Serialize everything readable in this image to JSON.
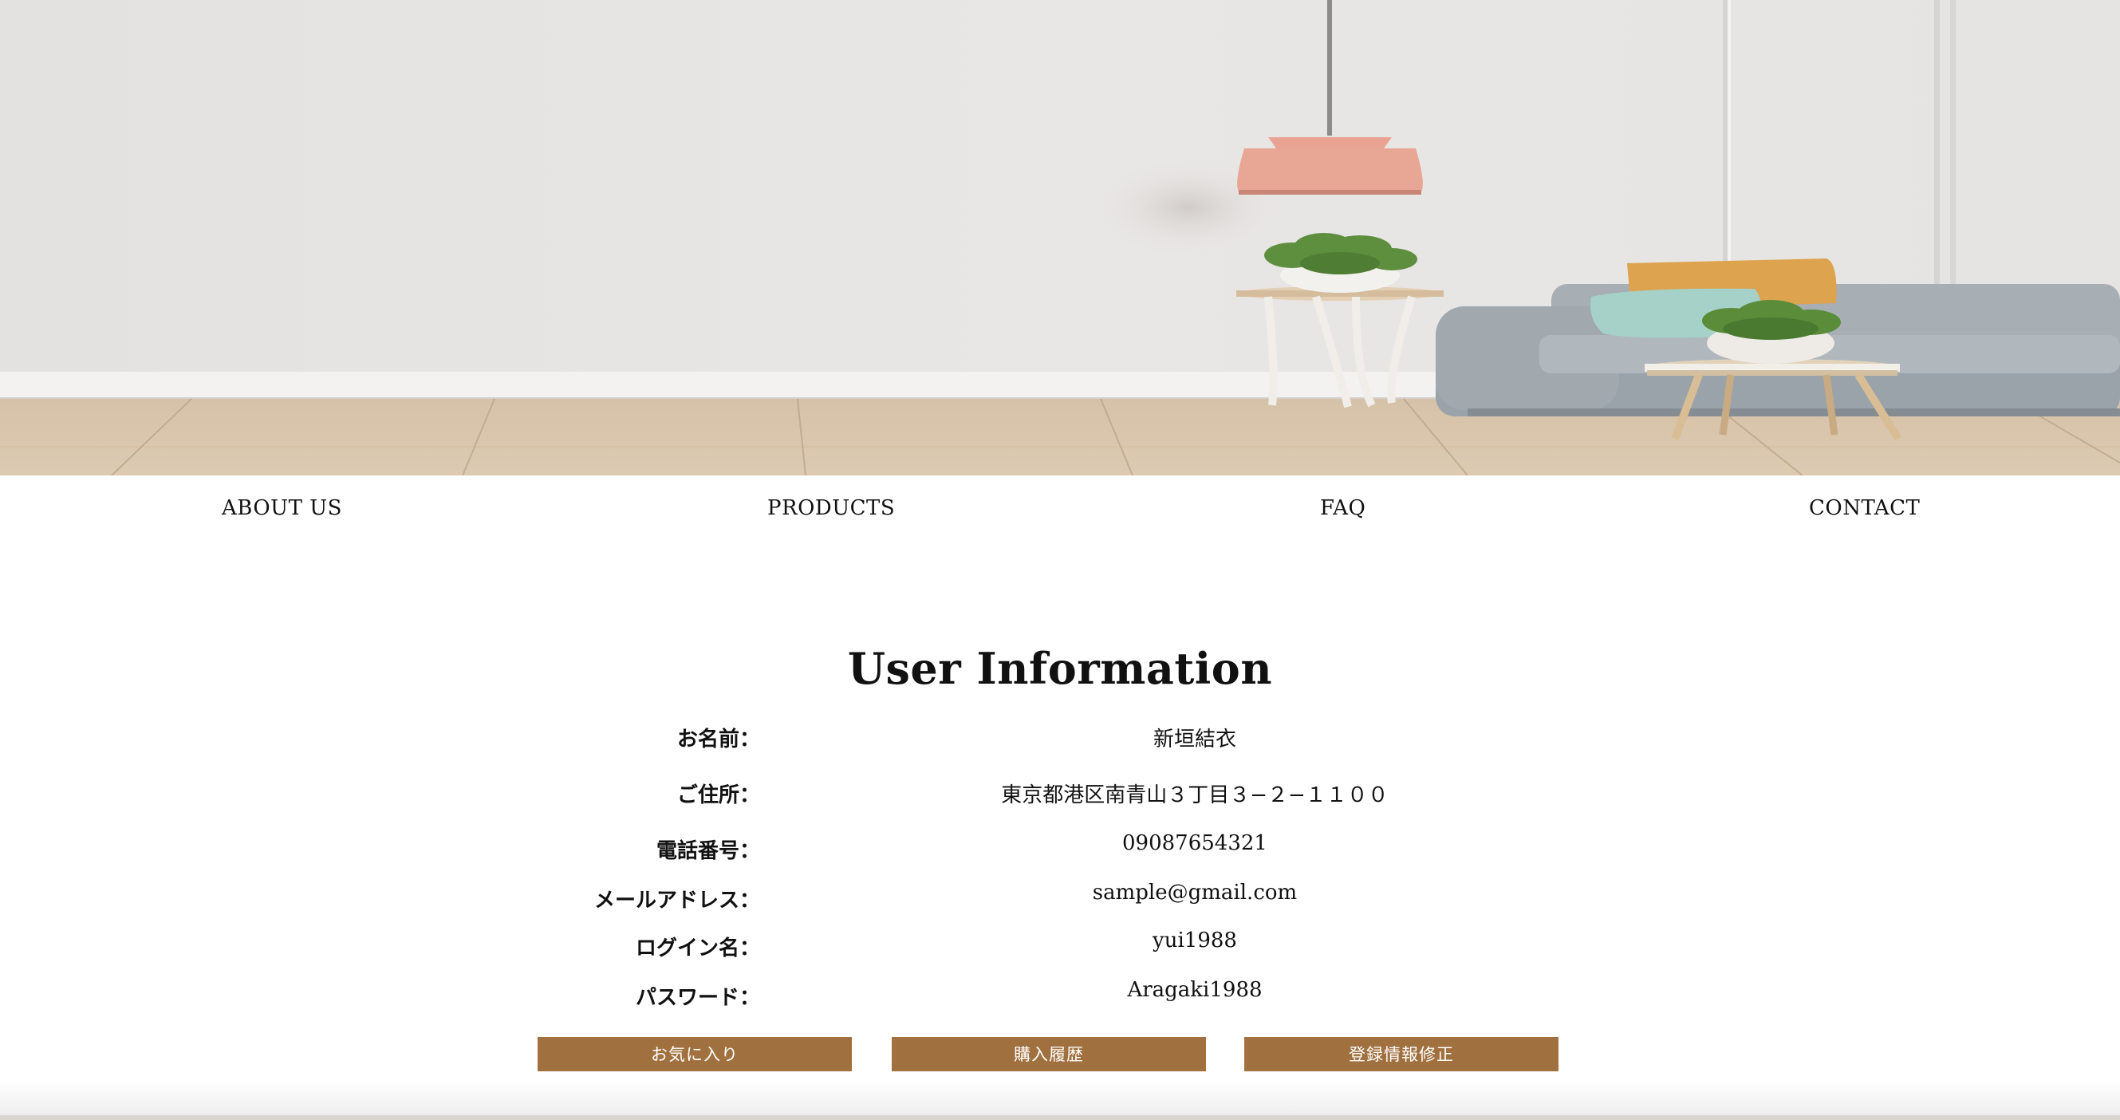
{
  "nav": {
    "items": [
      "ABOUT US",
      "PRODUCTS",
      "FAQ",
      "CONTACT"
    ]
  },
  "user_info": {
    "title": "User Information",
    "rows": [
      {
        "label": "お名前：",
        "value": "新垣結衣"
      },
      {
        "label": "ご住所：",
        "value": "東京都港区南青山３丁目３−２−１１００"
      },
      {
        "label": "電話番号：",
        "value": "09087654321"
      },
      {
        "label": "メールアドレス：",
        "value": "sample@gmail.com"
      },
      {
        "label": "ログイン名：",
        "value": "yui1988"
      },
      {
        "label": "パスワード：",
        "value": "Aragaki1988"
      }
    ]
  },
  "actions": {
    "favorites": "お気に入り",
    "purchase_history": "購入履歴",
    "edit_registration": "登録情報修正"
  },
  "colors": {
    "button": "#a0703f",
    "wall": "#e6e4e2",
    "floor": "#d8c4aa",
    "sofa": "#9aa3aa",
    "lamp": "#e8a695"
  }
}
